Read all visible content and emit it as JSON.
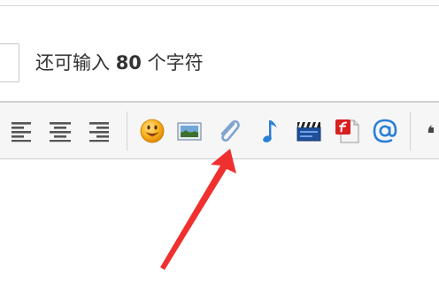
{
  "counter": {
    "prefix": "还可输入",
    "count": "80",
    "suffix": "个字符"
  },
  "toolbar": {
    "buttons": [
      {
        "name": "align-left",
        "icon": "align-left-icon"
      },
      {
        "name": "align-center",
        "icon": "align-center-icon"
      },
      {
        "name": "align-right",
        "icon": "align-right-icon"
      },
      {
        "name": "emoticon",
        "icon": "smiley-face-icon"
      },
      {
        "name": "insert-image",
        "icon": "image-icon"
      },
      {
        "name": "attachment",
        "icon": "paperclip-icon"
      },
      {
        "name": "insert-music",
        "icon": "music-note-icon"
      },
      {
        "name": "insert-video",
        "icon": "film-clapper-icon"
      },
      {
        "name": "insert-flash",
        "icon": "flash-document-icon"
      },
      {
        "name": "mention",
        "icon": "at-sign-icon"
      }
    ]
  },
  "annotation": {
    "arrow_color": "#f0302f",
    "points_to": "attachment"
  }
}
